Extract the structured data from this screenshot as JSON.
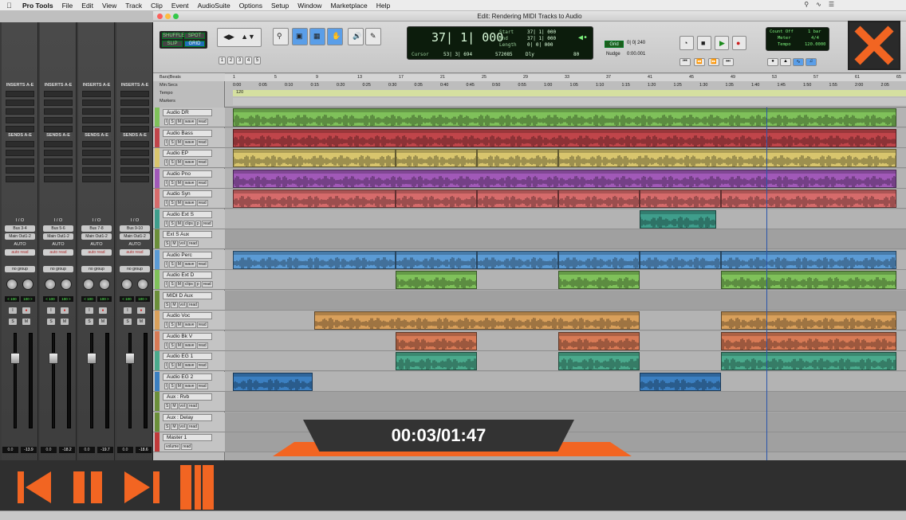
{
  "menubar": {
    "app": "Pro Tools",
    "items": [
      "File",
      "Edit",
      "View",
      "Track",
      "Clip",
      "Event",
      "AudioSuite",
      "Options",
      "Setup",
      "Window",
      "Marketplace",
      "Help"
    ]
  },
  "window": {
    "title": "Edit: Rendering MIDI Tracks to Audio"
  },
  "mixer": {
    "inserts_label": "INSERTS A-E",
    "sends_label": "SENDS A-E",
    "io_label": "I / O",
    "auto_label": "AUTO",
    "group_label": "no group",
    "strips": [
      {
        "input": "Bus 3-4",
        "output": "Main Out1-2",
        "auto": "auto read",
        "pan_l": "< 100",
        "pan_r": "100 >",
        "vol": "0.0",
        "peak": "-13.9"
      },
      {
        "input": "Bus 5-6",
        "output": "Main Out1-2",
        "auto": "auto read",
        "pan_l": "< 100",
        "pan_r": "100 >",
        "vol": "0.0",
        "peak": "-18.2"
      },
      {
        "input": "Bus 7-8",
        "output": "Main Out1-2",
        "auto": "auto read",
        "pan_l": "< 100",
        "pan_r": "100 >",
        "vol": "0.0",
        "peak": "-19.7"
      },
      {
        "input": "Bus 9-10",
        "output": "Main Out1-2",
        "auto": "auto read",
        "pan_l": "< 100",
        "pan_r": "100 >",
        "vol": "0.0",
        "peak": "-18.6"
      }
    ]
  },
  "toolbar": {
    "mode_shuffle": "SHUFFLE",
    "mode_spot": "SPOT",
    "mode_slip": "SLIP",
    "mode_grid": "GRID",
    "zoom_presets": [
      "1",
      "2",
      "3",
      "4",
      "5"
    ],
    "main_counter": "37| 1| 000",
    "start_label": "Start",
    "end_label": "End",
    "length_label": "Length",
    "start_value": "37| 1| 000",
    "end_value": "37| 1| 000",
    "length_value": "0| 0| 000",
    "cursor_label": "Cursor",
    "cursor_value": "53| 3| 694",
    "cursor_sample": "572085",
    "dly_label": "Dly",
    "grid_label": "Grid",
    "grid_value": "0| 0| 240",
    "nudge_label": "Nudge",
    "nudge_value": "0:00.001",
    "count_off_label": "Count Off",
    "count_off_value": "1 bar",
    "meter_label": "Meter",
    "meter_value": "4/4",
    "tempo_label": "Tempo",
    "tempo_value": "120.0000",
    "transport_val": "80"
  },
  "rulers": {
    "labels": [
      "Bars|Beats",
      "Min:Secs",
      "Tempo",
      "Markers"
    ],
    "bars": [
      "1",
      "5",
      "9",
      "13",
      "17",
      "21",
      "25",
      "29",
      "33",
      "37",
      "41",
      "45",
      "49",
      "53",
      "57",
      "61",
      "65"
    ],
    "secs": [
      "0:00",
      "0:05",
      "0:10",
      "0:15",
      "0:20",
      "0:25",
      "0:30",
      "0:35",
      "0:40",
      "0:45",
      "0:50",
      "0:55",
      "1:00",
      "1:05",
      "1:10",
      "1:15",
      "1:20",
      "1:25",
      "1:30",
      "1:35",
      "1:40",
      "1:45",
      "1:50",
      "1:55",
      "2:00",
      "2:05"
    ],
    "tempo": "120"
  },
  "tracks": [
    {
      "name": "Audio DR",
      "type": "audio",
      "color": "#7fc15a",
      "btns": [
        "I",
        "S",
        "M",
        "wave",
        "read"
      ]
    },
    {
      "name": "Audio Bass",
      "type": "audio",
      "color": "#c0454a",
      "btns": [
        "I",
        "S",
        "M",
        "wave",
        "read"
      ]
    },
    {
      "name": "Audio EP",
      "type": "audio",
      "color": "#d8c56d",
      "btns": [
        "I",
        "S",
        "M",
        "wave",
        "read"
      ]
    },
    {
      "name": "Audio Pno",
      "type": "audio",
      "color": "#a159b8",
      "btns": [
        "I",
        "S",
        "M",
        "wave",
        "read"
      ]
    },
    {
      "name": "Audio Syn",
      "type": "audio",
      "color": "#d66b6b",
      "btns": [
        "I",
        "S",
        "M",
        "wave",
        "read"
      ]
    },
    {
      "name": "Audio Ext S",
      "type": "audio",
      "color": "#3f9e8c",
      "btns": [
        "I",
        "S",
        "M",
        "clips",
        "p",
        "read"
      ]
    },
    {
      "name": "Ext S Aux",
      "type": "aux",
      "color": "#6b8f3a",
      "btns": [
        "S",
        "M",
        "vol",
        "read"
      ]
    },
    {
      "name": "Audio Perc",
      "type": "audio",
      "color": "#5b9bd5",
      "btns": [
        "I",
        "S",
        "M",
        "wave",
        "read"
      ]
    },
    {
      "name": "Audio Ext D",
      "type": "audio",
      "color": "#7fc15a",
      "btns": [
        "I",
        "S",
        "M",
        "clips",
        "p",
        "read"
      ]
    },
    {
      "name": "MIDI D Aux",
      "type": "aux",
      "color": "#6b8f3a",
      "btns": [
        "S",
        "M",
        "vol",
        "read"
      ]
    },
    {
      "name": "Audio Voc",
      "type": "audio",
      "color": "#d9a05b",
      "btns": [
        "I",
        "S",
        "M",
        "wave",
        "read"
      ]
    },
    {
      "name": "Audio Bk V",
      "type": "audio",
      "color": "#d87a55",
      "btns": [
        "I",
        "S",
        "M",
        "wave",
        "read"
      ]
    },
    {
      "name": "Audio EG 1",
      "type": "audio",
      "color": "#4aaa8c",
      "btns": [
        "I",
        "S",
        "M",
        "wave",
        "read"
      ]
    },
    {
      "name": "Audio EG 2",
      "type": "audio",
      "color": "#3b7fc1",
      "btns": [
        "I",
        "S",
        "M",
        "wave",
        "read"
      ]
    },
    {
      "name": "Aux : Rvb",
      "type": "aux",
      "color": "#6b8f3a",
      "btns": [
        "S",
        "M",
        "vol",
        "read"
      ]
    },
    {
      "name": "Aux : Delay",
      "type": "aux",
      "color": "#6b8f3a",
      "btns": [
        "S",
        "M",
        "vol",
        "read"
      ]
    },
    {
      "name": "Master 1",
      "type": "master",
      "color": "#c03a3a",
      "btns": [
        "volume",
        "read"
      ]
    }
  ],
  "player": {
    "time": "00:03/01:47"
  },
  "colors": {
    "accent": "#f26522",
    "overlay_dark": "#333333"
  }
}
